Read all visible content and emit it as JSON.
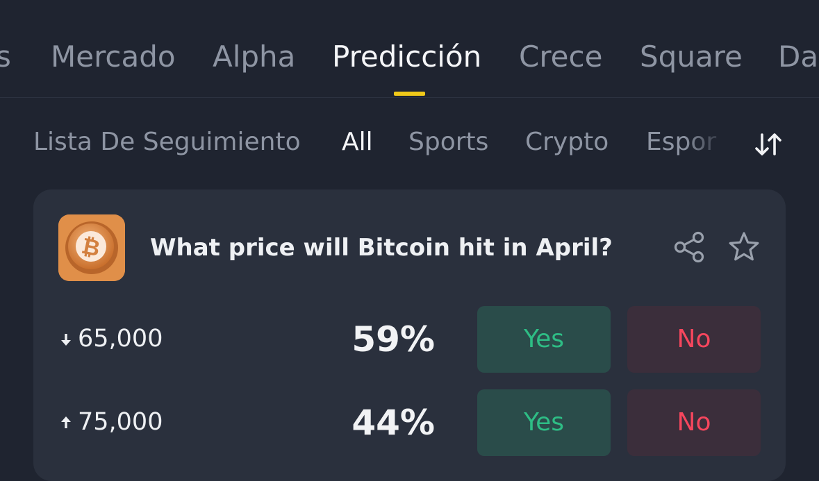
{
  "top_tabs": [
    {
      "label": "s"
    },
    {
      "label": "Mercado"
    },
    {
      "label": "Alpha"
    },
    {
      "label": "Predicción"
    },
    {
      "label": "Crece"
    },
    {
      "label": "Square"
    },
    {
      "label": "Da"
    }
  ],
  "active_top_tab": "Predicción",
  "sub_tabs": [
    {
      "label": "Lista De Seguimiento"
    },
    {
      "label": "All"
    },
    {
      "label": "Sports"
    },
    {
      "label": "Crypto"
    },
    {
      "label": "Espor"
    }
  ],
  "active_sub_tab": "All",
  "market": {
    "icon": "bitcoin-icon",
    "question": "What price will Bitcoin hit in April?",
    "outcomes": [
      {
        "direction": "down",
        "label": "65,000",
        "probability": "59%",
        "yes_label": "Yes",
        "no_label": "No"
      },
      {
        "direction": "up",
        "label": "75,000",
        "probability": "44%",
        "yes_label": "Yes",
        "no_label": "No"
      }
    ]
  },
  "colors": {
    "background": "#1f2430",
    "card": "#2a303d",
    "accent": "#f0c919",
    "yes": "#2ebd85",
    "no": "#f6465d"
  }
}
